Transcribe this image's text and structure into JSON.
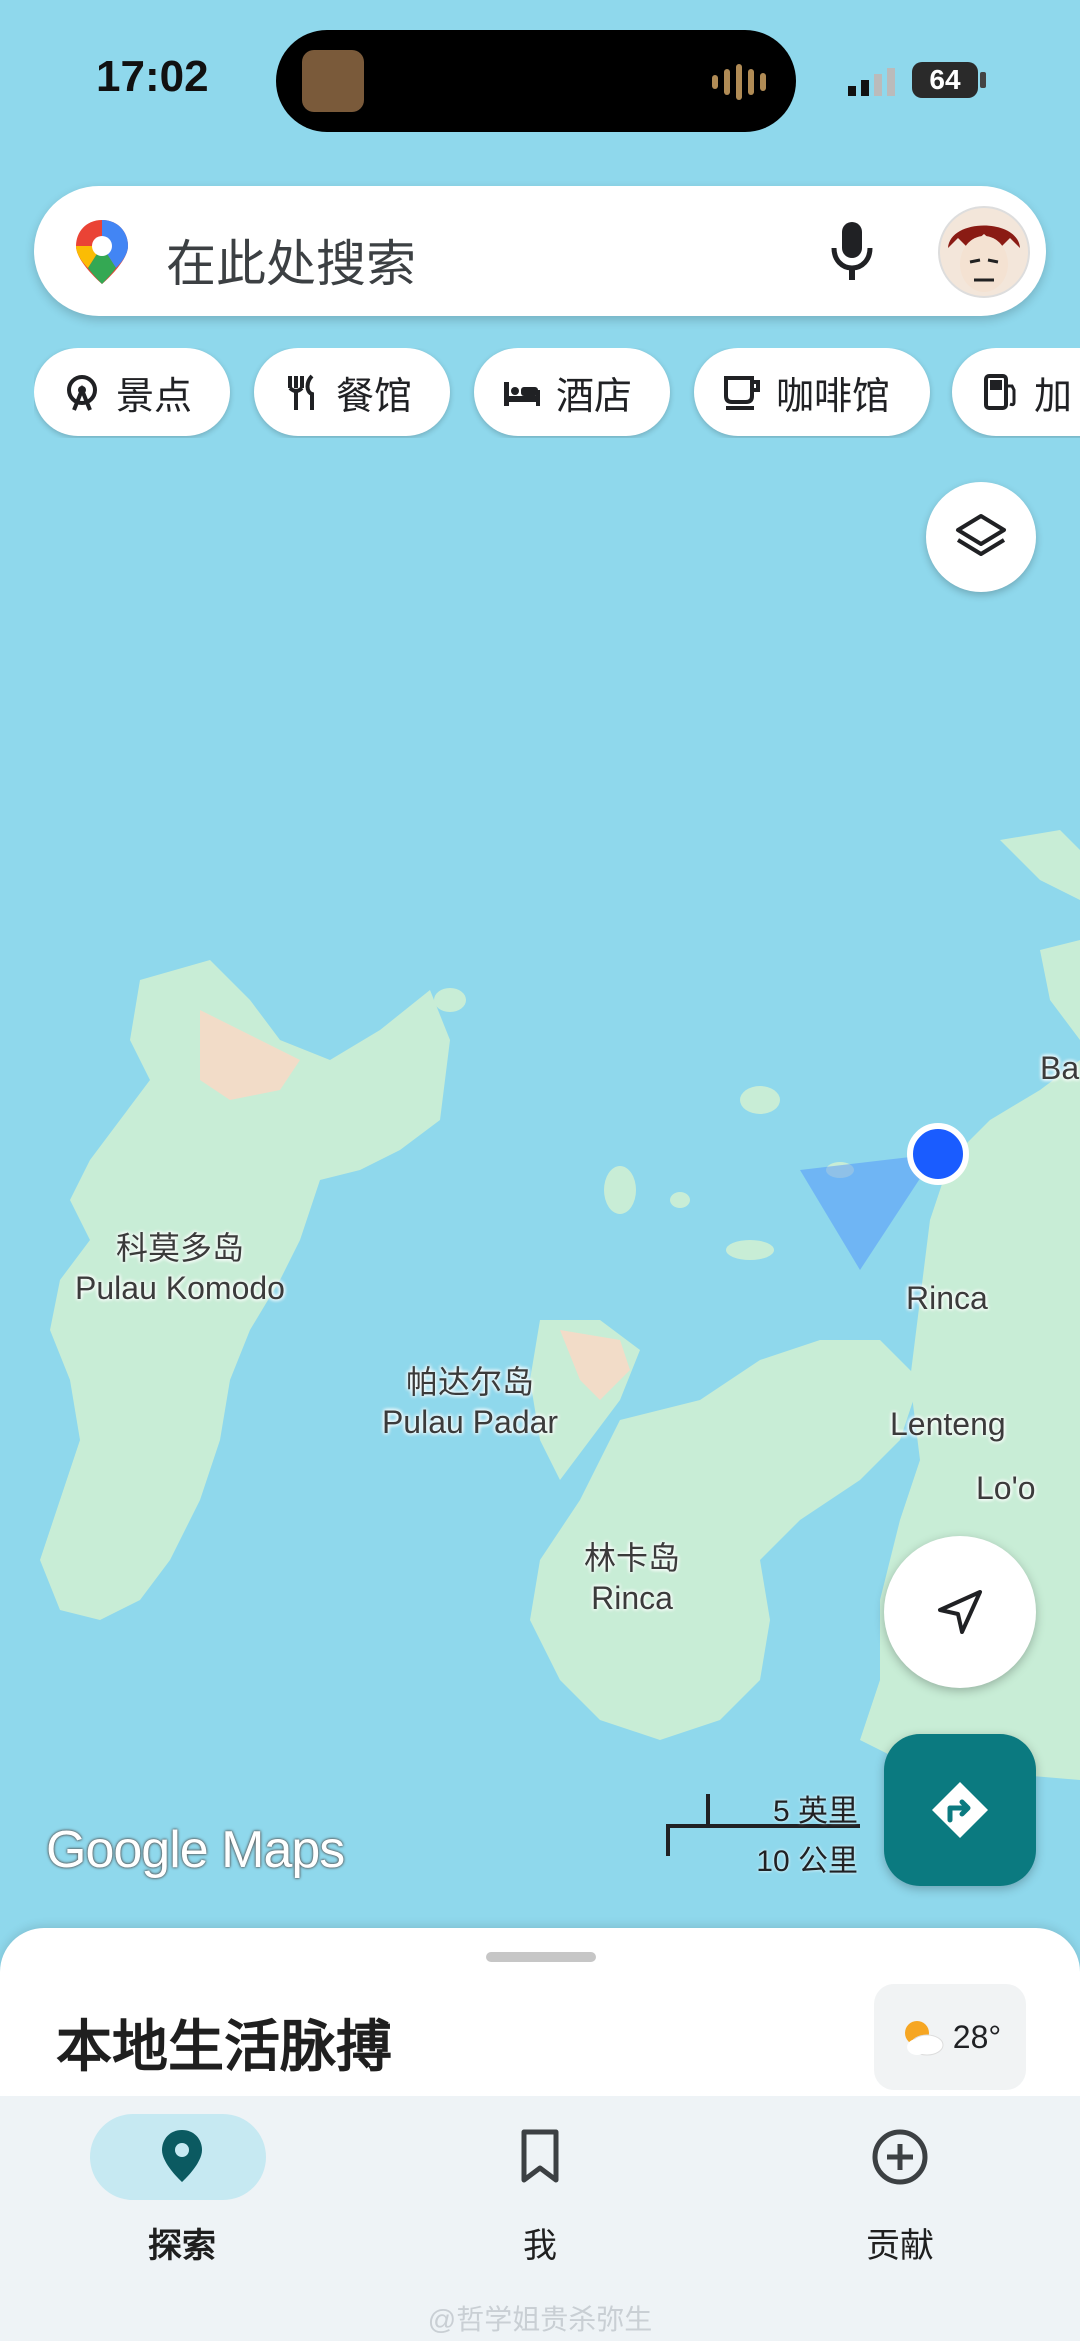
{
  "status_bar": {
    "time": "17:02",
    "battery": "64"
  },
  "search": {
    "placeholder": "在此处搜索",
    "pin_icon": "maps-pin-icon",
    "mic_icon": "mic-icon"
  },
  "chips": [
    {
      "label": "景点",
      "icon": "ferris-wheel-icon"
    },
    {
      "label": "餐馆",
      "icon": "fork-knife-icon"
    },
    {
      "label": "酒店",
      "icon": "bed-icon"
    },
    {
      "label": "咖啡馆",
      "icon": "coffee-cup-icon"
    },
    {
      "label": "加",
      "icon": "gas-station-icon"
    }
  ],
  "map_labels": {
    "komodo_cn": "科莫多岛",
    "komodo_en": "Pulau Komodo",
    "padar_cn": "帕达尔岛",
    "padar_en": "Pulau Padar",
    "rinca_island_cn": "林卡岛",
    "rinca_island_en": "Rinca",
    "rinca": "Rinca",
    "lenteng": "Lenteng",
    "loo": "Lo'o",
    "ba": "Ba"
  },
  "scale": {
    "top": "5 英里",
    "bottom": "10 公里"
  },
  "logo": "Google Maps",
  "sheet": {
    "title": "本地生活脉搏",
    "temperature": "28°",
    "weather_icon": "partly-cloudy-icon"
  },
  "bottom_nav": [
    {
      "label": "探索",
      "icon": "pin-icon",
      "active": true
    },
    {
      "label": "我",
      "icon": "bookmark-icon",
      "active": false
    },
    {
      "label": "贡献",
      "icon": "add-circle-icon",
      "active": false
    }
  ],
  "watermark": "@哲学姐贵杀弥生",
  "colors": {
    "water": "#8fd8ec",
    "land": "#c8edd6",
    "accent": "#0b7a80",
    "location": "#1a5cff",
    "nav_active": "#c6e9f2"
  }
}
